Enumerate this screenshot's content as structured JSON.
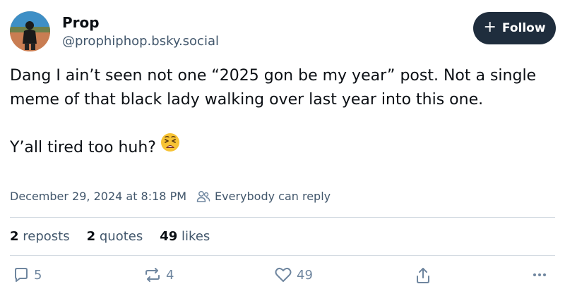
{
  "author": {
    "name": "Prop",
    "handle": "@prophiphop.bsky.social"
  },
  "follow_button": {
    "icon": "plus-icon",
    "label": "Follow"
  },
  "post": {
    "paragraph1": "Dang I ain’t seen not one “2025 gon be my year” post. Not a single meme of that black lady walking over last year into this one.",
    "paragraph2": "Y’all tired too huh?",
    "emoji": "tired-face-emoji"
  },
  "meta": {
    "timestamp": "December 29, 2024 at 8:18 PM",
    "reply_setting": "Everybody can reply",
    "reply_icon": "people-icon"
  },
  "stats": {
    "reposts_count": "2",
    "reposts_label": "reposts",
    "quotes_count": "2",
    "quotes_label": "quotes",
    "likes_count": "49",
    "likes_label": "likes"
  },
  "actions": {
    "reply_count": "5",
    "repost_count": "4",
    "like_count": "49"
  },
  "colors": {
    "text_primary": "#0b0f14",
    "text_secondary": "#42576c",
    "icon_muted": "#6f869f",
    "follow_bg": "#1f2d3d",
    "divider": "#d4dbe2"
  }
}
